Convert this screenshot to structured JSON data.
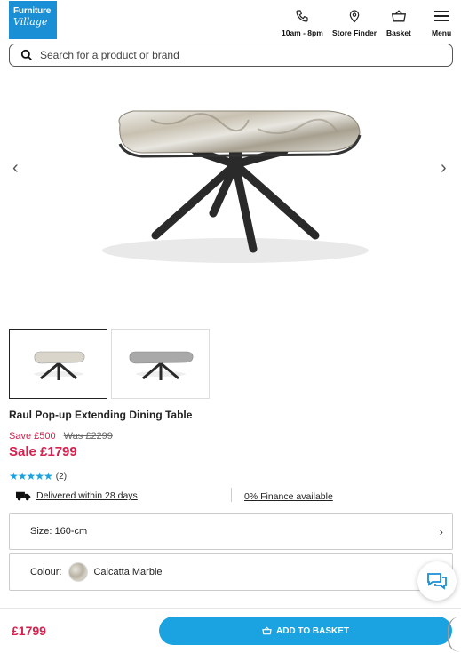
{
  "header": {
    "logo_line1": "Furniture",
    "logo_line2": "Village",
    "hours_label": "10am - 8pm",
    "store_finder_label": "Store Finder",
    "basket_label": "Basket",
    "menu_label": "Menu"
  },
  "search": {
    "placeholder": "Search for a product or brand"
  },
  "carousel": {
    "prev": "‹",
    "next": "›"
  },
  "product": {
    "title": "Raul Pop-up Extending Dining Table",
    "save_text": "Save £500",
    "was_text": "Was £2299",
    "sale_text": "Sale £1799",
    "rating_stars": "★★★★★",
    "rating_value": 5,
    "review_count": "(2)",
    "delivery_text": "Delivered within 28 days",
    "finance_text": "0% Finance available"
  },
  "options": {
    "size_label": "Size: 160-cm",
    "colour_label": "Colour:",
    "colour_value": "Calcatta Marble"
  },
  "bottom": {
    "price": "£1799",
    "add_to_basket": "ADD TO BASKET"
  },
  "colors": {
    "brand_blue": "#1a8fd6",
    "cta_blue": "#1aa3e0",
    "sale_red": "#d6214f"
  }
}
